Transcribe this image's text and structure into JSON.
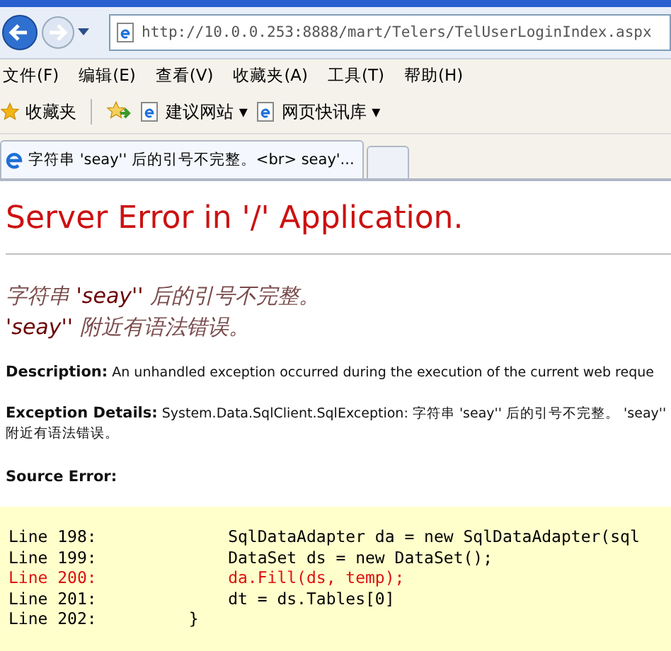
{
  "address_bar": {
    "url": "http://10.0.0.253:8888/mart/Telers/TelUserLoginIndex.aspx"
  },
  "menu_bar": [
    "文件(F)",
    "编辑(E)",
    "查看(V)",
    "收藏夹(A)",
    "工具(T)",
    "帮助(H)"
  ],
  "favorites_bar": {
    "favorites_label": "收藏夹",
    "links": [
      {
        "label": "建议网站 ▾"
      },
      {
        "label": "网页快讯库 ▾"
      }
    ]
  },
  "tabs": [
    {
      "title": "字符串 'seay'' 后的引号不完整。<br> seay'...",
      "selected": true
    }
  ],
  "page": {
    "heading": "Server Error in '/' Application.",
    "messages": [
      "字符串 **'seay''** 后的引号不完整。",
      "**'seay''** 附近有语法错误。"
    ],
    "description": {
      "label": "Description:",
      "text": "An unhandled exception occurred during the execution of the current web reque"
    },
    "exception_details": {
      "label": "Exception Details:",
      "text": "System.Data.SqlClient.SqlException: 字符串 'seay'' 后的引号不完整。 'seay'' 附近有语法错误。"
    },
    "source_error": {
      "label": "Source Error:",
      "lines": [
        {
          "number": "Line 198:",
          "code": "            SqlDataAdapter da = new SqlDataAdapter(sql",
          "error": false
        },
        {
          "number": "Line 199:",
          "code": "            DataSet ds = new DataSet();",
          "error": false
        },
        {
          "number": "Line 200:",
          "code": "            da.Fill(ds, temp);",
          "error": true
        },
        {
          "number": "Line 201:",
          "code": "            dt = ds.Tables[0]",
          "error": false
        },
        {
          "number": "Line 202:",
          "code": "        }",
          "error": false
        }
      ]
    }
  }
}
